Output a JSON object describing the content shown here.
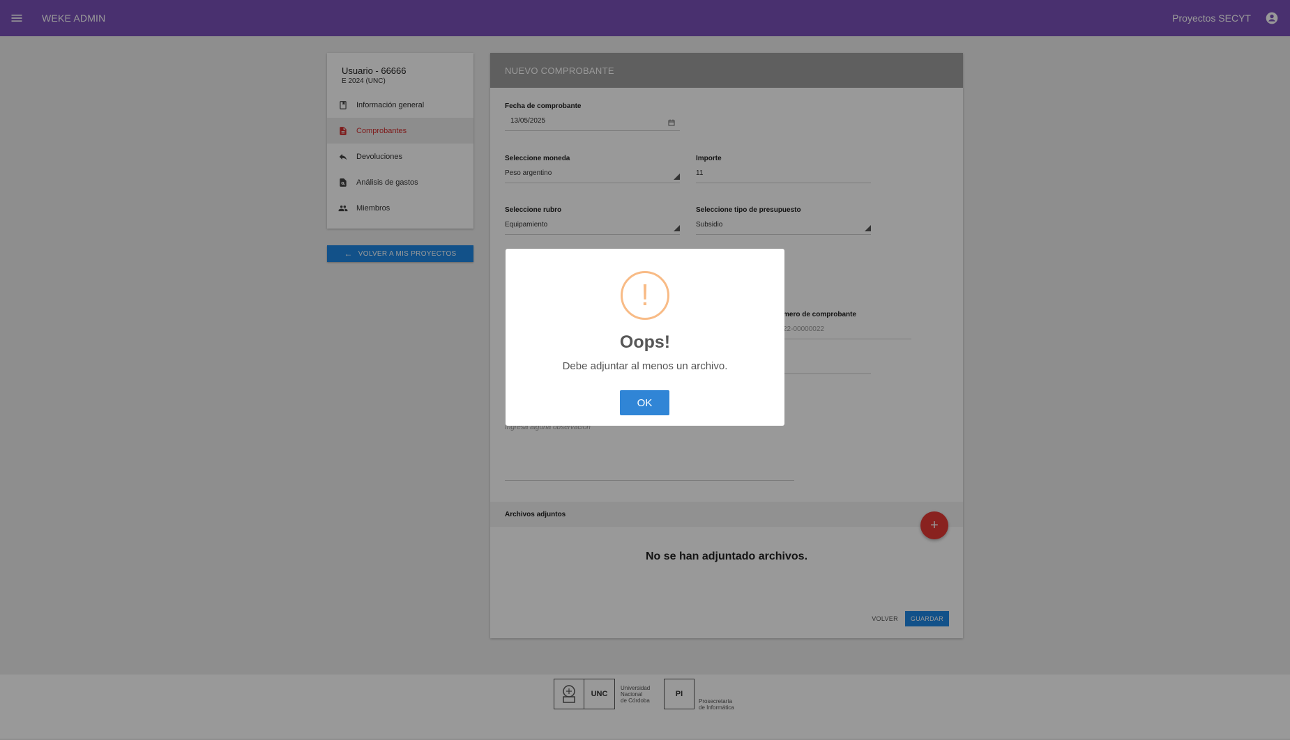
{
  "appbar": {
    "title": "WEKE ADMIN",
    "project": "Proyectos SECYT",
    "color": "#7b51b9"
  },
  "sidebar": {
    "user": "Usuario - 66666",
    "subtitle": "E 2024 (UNC)",
    "items": [
      {
        "label": "Información general",
        "icon": "book-icon"
      },
      {
        "label": "Comprobantes",
        "icon": "document-icon",
        "active": true
      },
      {
        "label": "Devoluciones",
        "icon": "reply-icon"
      },
      {
        "label": "Análisis de gastos",
        "icon": "search-document-icon"
      },
      {
        "label": "Miembros",
        "icon": "people-icon"
      }
    ],
    "back_label": "VOLVER A MIS PROYECTOS"
  },
  "form": {
    "header": "NUEVO COMPROBANTE",
    "fecha": {
      "label": "Fecha de comprobante",
      "value": "13/05/2025"
    },
    "moneda": {
      "label": "Seleccione moneda",
      "value": "Peso argentino"
    },
    "importe": {
      "label": "Importe",
      "value": "11"
    },
    "rubro": {
      "label": "Seleccione rubro",
      "value": "Equipamiento"
    },
    "tipo_presupuesto": {
      "label": "Seleccione tipo de presupuesto",
      "value": "Subsidio"
    },
    "numero": {
      "label_partial": "mero de comprobante",
      "value_partial": "22-00000022"
    },
    "observacion_placeholder": "Ingresá alguna observación",
    "attachments_title": "Archivos adjuntos",
    "no_files": "No se han adjuntado archivos.",
    "volver": "VOLVER",
    "guardar": "GUARDAR"
  },
  "footer": {
    "unc_abbr": "UNC",
    "unc_caption": [
      "Universidad",
      "Nacional",
      "de Córdoba"
    ],
    "pi_abbr": "PI",
    "pi_caption": [
      "Prosecretaría",
      "de Informática"
    ]
  },
  "modal": {
    "title": "Oops!",
    "text": "Debe adjuntar al menos un archivo.",
    "ok": "OK",
    "icon_glyph": "!",
    "icon_color": "#f8bb86",
    "button_color": "#3085d6"
  }
}
